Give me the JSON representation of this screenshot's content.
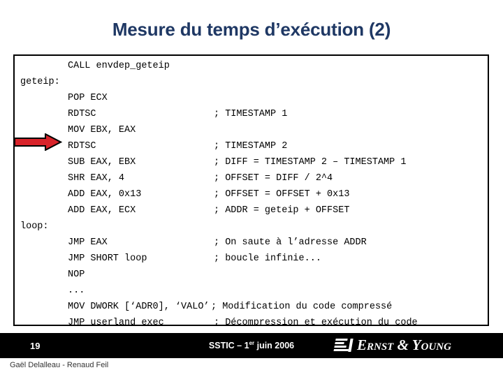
{
  "slide": {
    "title": "Mesure du temps d’exécution (2)",
    "title_color": "#1F3864",
    "background_color": "#FFFFFF"
  },
  "code_block": {
    "border_color": "#000000",
    "text_color": "#000000",
    "lines": [
      {
        "label": "",
        "instr": "CALL envdep_geteip",
        "comment": ""
      },
      {
        "label": "geteip:",
        "instr": "",
        "comment": ""
      },
      {
        "label": "",
        "instr": "POP ECX",
        "comment": ""
      },
      {
        "label": "",
        "instr": "RDTSC",
        "comment": "; TIMESTAMP 1"
      },
      {
        "label": "",
        "instr": "MOV EBX, EAX",
        "comment": ""
      },
      {
        "label": "",
        "instr": "RDTSC",
        "comment": "; TIMESTAMP 2"
      },
      {
        "label": "",
        "instr": "SUB EAX, EBX",
        "comment": "; DIFF = TIMESTAMP 2 – TIMESTAMP 1"
      },
      {
        "label": "",
        "instr": "SHR EAX, 4",
        "comment": "; OFFSET = DIFF / 2^4"
      },
      {
        "label": "",
        "instr": "ADD EAX, 0x13",
        "comment": "; OFFSET = OFFSET + 0x13"
      },
      {
        "label": "",
        "instr": "ADD EAX, ECX",
        "comment": "; ADDR = geteip + OFFSET"
      },
      {
        "label": "loop:",
        "instr": "",
        "comment": ""
      },
      {
        "label": "",
        "instr": "JMP EAX",
        "comment": "; On saute à l’adresse ADDR"
      },
      {
        "label": "",
        "instr": "JMP SHORT loop",
        "comment": "; boucle infinie..."
      },
      {
        "label": "",
        "instr": "NOP",
        "comment": ""
      },
      {
        "label": "",
        "instr": "...",
        "comment": ""
      },
      {
        "label": "",
        "instr": "MOV DWORK [‘ADR0], ‘VALO’",
        "comment": "; Modification du code compressé",
        "comment_inline": true
      },
      {
        "label": "",
        "instr": "JMP userland_exec",
        "comment": "; Décompression et exécution du code",
        "comment_inline": true
      }
    ]
  },
  "marker": {
    "type": "right-arrow",
    "fill_color": "#D8232A",
    "outline_color": "#000000",
    "points_at_line": "RDTSC ; TIMESTAMP 2"
  },
  "footer": {
    "bar_color": "#000000",
    "slide_number": "19",
    "event_prefix": "SSTIC – 1",
    "event_sup": "er",
    "event_suffix": " juin 2006",
    "logo_text": "Ernst & Young",
    "authors": "Gaël Delalleau - Renaud Feil"
  }
}
